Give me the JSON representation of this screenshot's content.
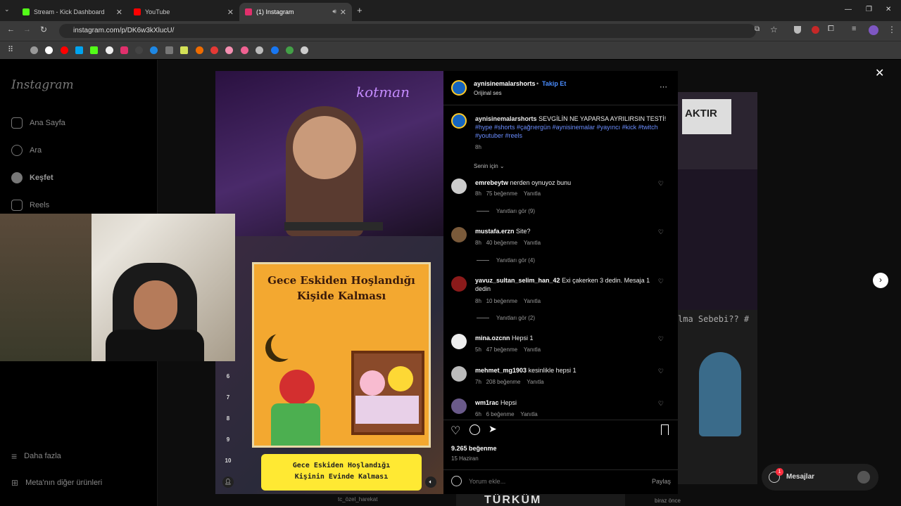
{
  "browser": {
    "tabs": [
      {
        "label": "Stream - Kick Dashboard",
        "color": "#53fc18"
      },
      {
        "label": "YouTube",
        "color": "#ff0000"
      },
      {
        "label": "(1) Instagram",
        "color": "#e1306c"
      }
    ],
    "url": "instagram.com/p/DK6w3kXlucU/"
  },
  "sidebar": {
    "logo": "Instagram",
    "items": [
      {
        "label": "Ana Sayfa",
        "icon": "home-icon"
      },
      {
        "label": "Ara",
        "icon": "search-icon"
      },
      {
        "label": "Keşfet",
        "icon": "compass-icon"
      },
      {
        "label": "Reels",
        "icon": "reels-icon"
      }
    ],
    "more": "Daha fazla",
    "meta": "Meta'nın diğer ürünleri"
  },
  "post": {
    "username": "aynisinemalarshorts",
    "follow": "Takip Et",
    "audio": "Orijinal ses",
    "caption_user": "aynisinemalarshorts",
    "caption_text": "SEVGİLİN NE YAPARSA AYRILIRSIN TESTİ!",
    "caption_tags": "#hype #shorts #çağrıergün #aynisinemalar #yayıncı #kick #twitch #youtuber #reels",
    "caption_time": "8h",
    "filter": "Senin için",
    "likes": "9.265 beğenme",
    "date": "15 Haziran",
    "comment_placeholder": "Yorum ekle...",
    "share": "Paylaş",
    "media_title": "Gece Eskiden Hoşlandığı Kişide Kalması",
    "media_caption_1": "Gece Eskiden Hoşlandığı",
    "media_caption_2": "Kişinin Evinde Kalması",
    "rank_numbers": [
      "6",
      "7",
      "8",
      "9",
      "10"
    ]
  },
  "comments": [
    {
      "user": "emrebeytw",
      "text": "nerden oynuyoz bunu",
      "time": "8h",
      "likes": "75 beğenme",
      "reply": "Yanıtla",
      "replies": "Yanıtları gör (9)"
    },
    {
      "user": "mustafa.erzn",
      "text": "Site?",
      "time": "8h",
      "likes": "40 beğenme",
      "reply": "Yanıtla",
      "replies": "Yanıtları gör (4)"
    },
    {
      "user": "yavuz_sultan_selim_han_42",
      "text": "Exi çakerken 3 dedin. Mesaja 1 dedin",
      "time": "8h",
      "likes": "10 beğenme",
      "reply": "Yanıtla",
      "replies": "Yanıtları gör (2)"
    },
    {
      "user": "mina.ozcnn",
      "text": "Hepsi 1",
      "time": "5h",
      "likes": "47 beğenme",
      "reply": "Yanıtla"
    },
    {
      "user": "mehmet_mg1903",
      "text": "kesinlikle hepsi 1",
      "time": "7h",
      "likes": "208 beğenme",
      "reply": "Yanıtla"
    },
    {
      "user": "wm1rac",
      "text": "Hepsi",
      "time": "6h",
      "likes": "6 beğenme",
      "reply": "Yanıtla"
    }
  ],
  "background": {
    "right_text": "lma Sebebi?? #",
    "bottom_text": "TÜRKÜM",
    "poster_text": "AKTIR",
    "time_ago": "biraz önce",
    "bottom_handle": "tc_özel_harekat"
  },
  "messages": {
    "label": "Mesajlar",
    "badge": "1"
  }
}
